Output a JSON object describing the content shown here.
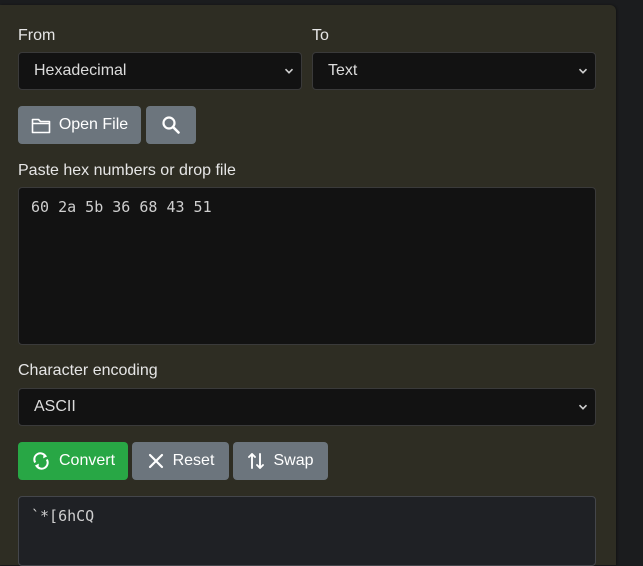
{
  "from": {
    "label": "From",
    "selected": "Hexadecimal"
  },
  "to": {
    "label": "To",
    "selected": "Text"
  },
  "toolbar": {
    "open_file_label": "Open File",
    "search_icon": "search-icon",
    "folder_icon": "folder-icon"
  },
  "input": {
    "label": "Paste hex numbers or drop file",
    "value": "60 2a 5b 36 68 43 51"
  },
  "encoding": {
    "label": "Character encoding",
    "selected": "ASCII"
  },
  "actions": {
    "convert_label": "Convert",
    "reset_label": "Reset",
    "swap_label": "Swap"
  },
  "output": {
    "value": "`*[6hCQ"
  },
  "colors": {
    "panel": "#2e2d23",
    "field": "#121212",
    "gray_button": "#6c757d",
    "green_button": "#28a745"
  }
}
